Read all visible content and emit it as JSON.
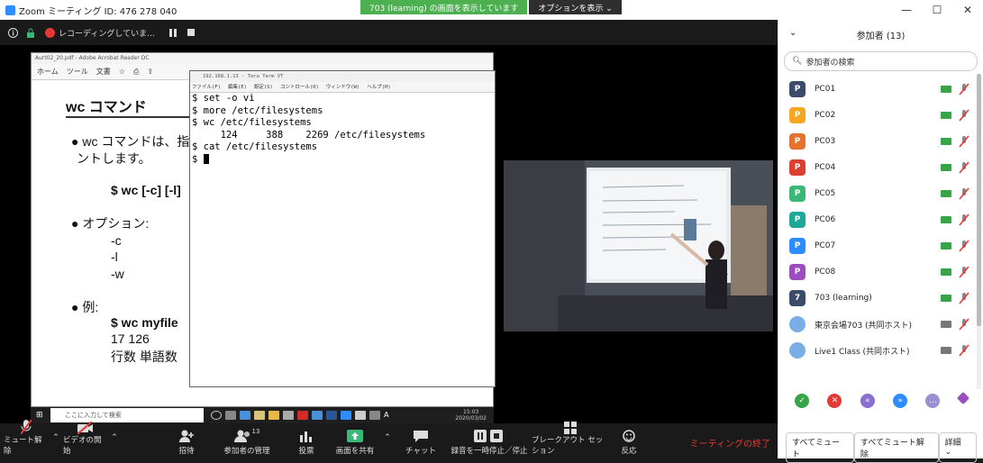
{
  "window": {
    "title": "Zoom ミーティング ID: 476 278 040",
    "min": "—",
    "max": "☐",
    "close": "✕"
  },
  "share_banner": {
    "text": "703 (learning) の画面を表示しています",
    "options": "オプションを表示 ⌄"
  },
  "topbar": {
    "recording": "レコーディングしていま..."
  },
  "acrobat": {
    "title": "Aurt02_20.pdf - Adobe Acrobat Reader DC",
    "tabs": [
      "ホーム",
      "ツール",
      "文書"
    ]
  },
  "slide": {
    "title": "wc コマンド",
    "line1": "● wc コマンドは、指定",
    "line2": "ントします。",
    "syntax": "$ wc [-c] [-l]",
    "options_heading": "● オプション:",
    "opt_c": "-c",
    "opt_l": "-l",
    "opt_w": "-w",
    "example_heading": "● 例:",
    "example_cmd": "$ wc myfile",
    "example_nums": "17      126",
    "example_labels": "行数    単語数"
  },
  "teraterm": {
    "title": "192.168.1.13 - Tera Term VT",
    "menu": [
      "ファイル(F)",
      "編集(E)",
      "設定(S)",
      "コントロール(O)",
      "ウィンドウ(W)",
      "ヘルプ(H)"
    ],
    "lines": [
      "$ set -o vi",
      "$ more /etc/filesystems",
      "$ wc /etc/filesystems",
      "     124     388    2269 /etc/filesystems",
      "$ cat /etc/filesystems",
      "$ "
    ]
  },
  "taskbar": {
    "search": "ここに入力して検索",
    "time": "15:03",
    "date": "2020/03/02",
    "ime": "A"
  },
  "toolbar": {
    "mute": "ミュート解除",
    "video": "ビデオの開始",
    "invite": "招待",
    "participants": "参加者の管理",
    "participants_count": "13",
    "poll": "投票",
    "share": "画面を共有",
    "chat": "チャット",
    "pause": "録音を一時停止／停止",
    "breakout": "ブレークアウト セッション",
    "reactions": "反応",
    "end": "ミーティングの終了"
  },
  "panel": {
    "header": "参加者 (13)",
    "search_placeholder": "参加者の検索",
    "participants": [
      {
        "initial": "P",
        "name": "PC01",
        "color": "#3b4c6b"
      },
      {
        "initial": "P",
        "name": "PC02",
        "color": "#f5a623"
      },
      {
        "initial": "P",
        "name": "PC03",
        "color": "#e5722e"
      },
      {
        "initial": "P",
        "name": "PC04",
        "color": "#d94032"
      },
      {
        "initial": "P",
        "name": "PC05",
        "color": "#3bb878"
      },
      {
        "initial": "P",
        "name": "PC06",
        "color": "#1fa89a"
      },
      {
        "initial": "P",
        "name": "PC07",
        "color": "#2d8cff"
      },
      {
        "initial": "P",
        "name": "PC08",
        "color": "#9b4dbf"
      },
      {
        "initial": "7",
        "name": "703 (learning)",
        "color": "#3b4c6b"
      },
      {
        "initial": "",
        "name": "東京会場703 (共同ホスト)",
        "color": "#7aaee6"
      },
      {
        "initial": "",
        "name": "Live1 Class (共同ホスト)",
        "color": "#7aaee6"
      }
    ],
    "mute_all": "すべてミュート",
    "unmute_all": "すべてミュート解除",
    "more": "詳細 ⌄"
  }
}
